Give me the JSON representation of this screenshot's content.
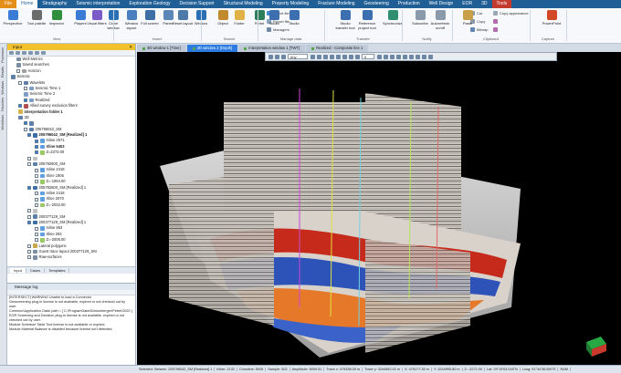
{
  "ribbon_tabs": [
    {
      "label": "File",
      "style": "file"
    },
    {
      "label": "Home",
      "style": "active"
    },
    {
      "label": "Stratigraphy",
      "style": ""
    },
    {
      "label": "Seismic interpretation",
      "style": ""
    },
    {
      "label": "Exploration Geology",
      "style": ""
    },
    {
      "label": "Decision Support",
      "style": ""
    },
    {
      "label": "Structural Modeling",
      "style": ""
    },
    {
      "label": "Property Modeling",
      "style": ""
    },
    {
      "label": "Fracture Modeling",
      "style": ""
    },
    {
      "label": "Geosteering",
      "style": ""
    },
    {
      "label": "Production",
      "style": ""
    },
    {
      "label": "Well Design",
      "style": ""
    },
    {
      "label": "EOR",
      "style": ""
    },
    {
      "label": "3D",
      "style": ""
    },
    {
      "label": "Tools",
      "style": "tools"
    }
  ],
  "ribbon_buttons": [
    {
      "label": "Perspective",
      "color": "#3a7bd5"
    },
    {
      "label": "Tool palette",
      "color": "#6b6b6b"
    },
    {
      "label": "Inspector",
      "color": "#2f8f3a"
    },
    {
      "label": "Players",
      "color": "#3a7bd5"
    },
    {
      "label": "Visual filters",
      "color": "#7a5bc7"
    },
    {
      "label": "Clone window",
      "color": "#2b6fb5"
    },
    {
      "label": "Window layout",
      "color": "#4a7fbf"
    },
    {
      "label": "Full screen",
      "color": "#3d6ea6"
    },
    {
      "label": "Panes",
      "color": "#5b87b8"
    },
    {
      "label": "Reset layout",
      "color": "#4d7aa8"
    },
    {
      "label": "Window",
      "color": "#2b6fb5"
    },
    {
      "label": "Object",
      "color": "#c08a2d"
    },
    {
      "label": "Folder",
      "color": "#e0b245"
    },
    {
      "label": "Petrel",
      "color": "#2e7d5b"
    },
    {
      "label": "Studio",
      "color": "#3b6fb0"
    },
    {
      "label": "Studio",
      "color": "#3b6fb0"
    },
    {
      "label": "Studio transfer tool",
      "color": "#3b6fb0"
    },
    {
      "label": "Reference project tool",
      "color": "#3b6fb0"
    },
    {
      "label": "Synchronize",
      "color": "#2f8f6f"
    },
    {
      "label": "Subscribe",
      "color": "#8a9aab"
    },
    {
      "label": "Autorefresh on/off",
      "color": "#8a9aab"
    },
    {
      "label": "Paste",
      "color": "#c9a04a"
    },
    {
      "label": "PowerPoint",
      "color": "#d24726"
    }
  ],
  "ribbon_small": {
    "import_file": "Import file",
    "export_file": "Export file",
    "managers": "Managers",
    "cut": "Cut",
    "copy": "Copy",
    "bitmap": "Bitmap",
    "copy_appearance": "Copy appearance"
  },
  "ribbon_groups": [
    "View",
    "Insert",
    "Search",
    "Manage data",
    "Transfer",
    "Notify",
    "Clipboard",
    "Capture"
  ],
  "input_panel": {
    "title": "Input",
    "tree": [
      {
        "text": "Well Metrics",
        "indent": 10,
        "cb": "none",
        "ico": "#7a8ea3",
        "style": ""
      },
      {
        "text": "Saved searches",
        "indent": 10,
        "cb": "none",
        "ico": "#7a8ea3",
        "style": ""
      },
      {
        "text": "Horizon",
        "indent": 10,
        "cb": "off",
        "ico": "#a0a0a0",
        "style": ""
      },
      {
        "text": "Seismic",
        "indent": 4,
        "cb": "none",
        "ico": "#5d7fa8",
        "style": ""
      },
      {
        "text": "Wavelets",
        "indent": 12,
        "cb": "off",
        "ico": "#5d7fa8",
        "style": ""
      },
      {
        "text": "Seismic Time 1",
        "indent": 18,
        "cb": "off",
        "ico": "#7d9fc7",
        "style": ""
      },
      {
        "text": "Seismic Time 2",
        "indent": 18,
        "cb": "none",
        "ico": "#7d9fc7",
        "style": ""
      },
      {
        "text": "Realized",
        "indent": 18,
        "cb": "on",
        "ico": "#7d9fc7",
        "style": ""
      },
      {
        "text": "Allied survey exclusion filters",
        "indent": 12,
        "cb": "on",
        "ico": "#b24e4e",
        "style": ""
      },
      {
        "text": "Interpretation folder 1",
        "indent": 12,
        "cb": "none",
        "ico": "#d8b24a",
        "style": "bold"
      },
      {
        "text": "3D",
        "indent": 12,
        "cb": "none",
        "ico": "#5d7fa8",
        "style": ""
      },
      {
        "text": "",
        "indent": 18,
        "cb": "on",
        "ico": "#5d7fa8",
        "style": ""
      },
      {
        "text": "205796042_SM",
        "indent": 18,
        "cb": "off",
        "ico": "#5d7fa8",
        "style": ""
      },
      {
        "text": "205796042_SM [Realized] 1",
        "indent": 22,
        "cb": "on",
        "ico": "#3a6ea5",
        "style": "bold"
      },
      {
        "text": "Inline 2571",
        "indent": 30,
        "cb": "on",
        "ico": "#5e9fe0",
        "style": ""
      },
      {
        "text": "Xline 5403",
        "indent": 30,
        "cb": "on",
        "ico": "#5e9fe0",
        "style": "bold"
      },
      {
        "text": "Z=2372.00",
        "indent": 30,
        "cb": "on",
        "ico": "#9ac867",
        "style": ""
      },
      {
        "text": "",
        "indent": 22,
        "cb": "off",
        "ico": "#c0c0c0",
        "style": ""
      },
      {
        "text": "205782600_SM",
        "indent": 22,
        "cb": "off",
        "ico": "#5d7fa8",
        "style": ""
      },
      {
        "text": "Inline 2418",
        "indent": 30,
        "cb": "off",
        "ico": "#5e9fe0",
        "style": ""
      },
      {
        "text": "Xline 1906",
        "indent": 30,
        "cb": "off",
        "ico": "#5e9fe0",
        "style": ""
      },
      {
        "text": "Z=-1994.00",
        "indent": 30,
        "cb": "off",
        "ico": "#9ac867",
        "style": ""
      },
      {
        "text": "205782600_SM [Realized] 1",
        "indent": 22,
        "cb": "on",
        "ico": "#3a6ea5",
        "style": ""
      },
      {
        "text": "Inline 2418",
        "indent": 30,
        "cb": "off",
        "ico": "#5e9fe0",
        "style": ""
      },
      {
        "text": "Xline 2070",
        "indent": 30,
        "cb": "off",
        "ico": "#5e9fe0",
        "style": ""
      },
      {
        "text": "Z=-2032.00",
        "indent": 30,
        "cb": "off",
        "ico": "#9ac867",
        "style": ""
      },
      {
        "text": "",
        "indent": 22,
        "cb": "off",
        "ico": "#c0c0c0",
        "style": ""
      },
      {
        "text": "200377129_SM",
        "indent": 22,
        "cb": "off",
        "ico": "#5d7fa8",
        "style": ""
      },
      {
        "text": "200377129_SM [Realized] 1",
        "indent": 22,
        "cb": "on",
        "ico": "#3a6ea5",
        "style": ""
      },
      {
        "text": "Inline 953",
        "indent": 30,
        "cb": "off",
        "ico": "#5e9fe0",
        "style": ""
      },
      {
        "text": "Xline 293",
        "indent": 30,
        "cb": "off",
        "ico": "#5e9fe0",
        "style": ""
      },
      {
        "text": "Z=-2008.00",
        "indent": 30,
        "cb": "off",
        "ico": "#9ac867",
        "style": ""
      },
      {
        "text": "Lateral polygons",
        "indent": 22,
        "cb": "off",
        "ico": "#c8a84a",
        "style": ""
      },
      {
        "text": "Guest trace layout 200377129_SM",
        "indent": 22,
        "cb": "off",
        "ico": "#7a8ea3",
        "style": ""
      },
      {
        "text": "Raw-surfaces",
        "indent": 22,
        "cb": "off",
        "ico": "#7a8ea3",
        "style": ""
      }
    ],
    "tabs": [
      "Input",
      "Cases",
      "Templates"
    ]
  },
  "left_strip": [
    "Processes",
    "Results",
    "Windows",
    "Favorites",
    "Workflows"
  ],
  "message_log": {
    "title": "Message log",
    "lines": [
      "[INTERSECT]  WARNING   Unable to load a Connector",
      "Geoscreening plug-in license is not available, expired or not checked out by",
      "user",
      "Common\\Application Data\\ path = [ C:\\ProgramData\\Schlumberger\\Petrel\\2020 ]",
      "EOR Screening and Decision plug-in license is not available, expired or not",
      "checked out by user.",
      "Module Schedule Table Tool license is not available or expired.",
      "Module Material Balance is disabled because license isn't detected."
    ]
  },
  "window_tabs": [
    {
      "label": "3D window 1 [Time]",
      "active": false
    },
    {
      "label": "3D window 2 [Depth]",
      "active": true
    },
    {
      "label": "Interpretation window 1 [TWT]",
      "active": false
    },
    {
      "label": "Realized - Composite line 1",
      "active": false
    }
  ],
  "viewer_toolbar": {
    "mode": "Any",
    "count": "5"
  },
  "status_bar": [
    "Selected: Seismic: 205796042_SM [Realized] 1",
    "Inline: 2132",
    "Crossline: 5926",
    "Sample: 502",
    "Amplitude: 6909.51",
    "Trace x: 479338.05 m",
    "Trace y: 3244962.02 m",
    "X: 475177.35 m",
    "Y: 3244995.80 m",
    "Z: -2272.00",
    "Lat: 29°19'03.018\"N",
    "Long: 91°44'36.550\"E",
    "RAM"
  ],
  "colors": {
    "accent": "#1f5f96",
    "file_tab": "#e48f19",
    "tools_tab": "#c43b2e",
    "active_window_tab": "#2b7be1",
    "panel_title": "#f2c12e"
  }
}
